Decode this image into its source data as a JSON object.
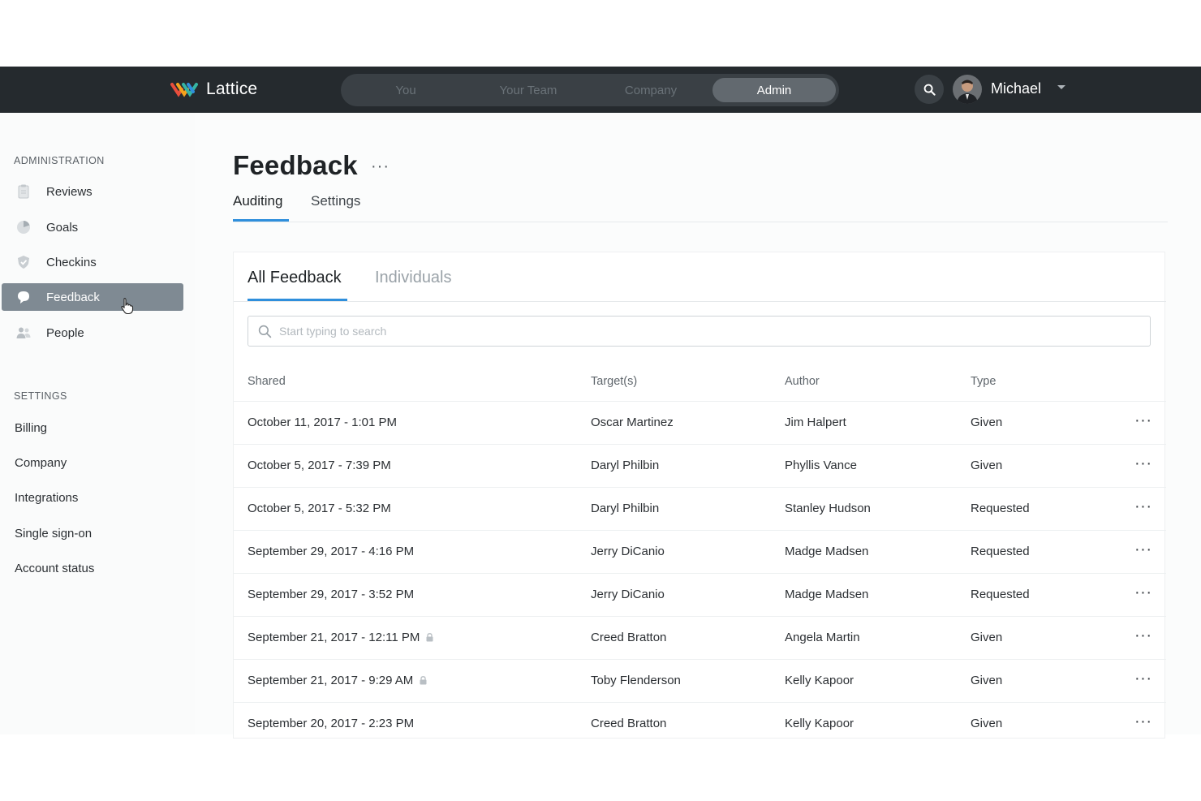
{
  "app": {
    "name": "Lattice",
    "colors": {
      "topbar": "#252a2e",
      "accent": "#2f8fdc",
      "active_sidebar": "#7f8a93"
    }
  },
  "topnav": {
    "items": [
      {
        "label": "You",
        "active": false
      },
      {
        "label": "Your Team",
        "active": false
      },
      {
        "label": "Company",
        "active": false
      },
      {
        "label": "Admin",
        "active": true
      }
    ],
    "search_icon": "search-icon",
    "user": {
      "name": "Michael",
      "caret_icon": "caret-down-icon"
    }
  },
  "sidebar": {
    "administration_heading": "ADMINISTRATION",
    "admin_items": [
      {
        "label": "Reviews",
        "icon": "clipboard-icon",
        "active": false
      },
      {
        "label": "Goals",
        "icon": "goal-pie-icon",
        "active": false
      },
      {
        "label": "Checkins",
        "icon": "checkin-shield-icon",
        "active": false
      },
      {
        "label": "Feedback",
        "icon": "chat-bubble-icon",
        "active": true
      },
      {
        "label": "People",
        "icon": "people-icon",
        "active": false
      }
    ],
    "settings_heading": "SETTINGS",
    "settings_items": [
      {
        "label": "Billing"
      },
      {
        "label": "Company"
      },
      {
        "label": "Integrations"
      },
      {
        "label": "Single sign-on"
      },
      {
        "label": "Account status"
      }
    ]
  },
  "page": {
    "title": "Feedback",
    "more": "···",
    "tabs": [
      {
        "label": "Auditing",
        "active": true
      },
      {
        "label": "Settings",
        "active": false
      }
    ]
  },
  "card": {
    "subtabs": [
      {
        "label": "All Feedback",
        "active": true
      },
      {
        "label": "Individuals",
        "active": false
      }
    ],
    "search": {
      "placeholder": "Start typing to search",
      "value": ""
    },
    "columns": [
      "Shared",
      "Target(s)",
      "Author",
      "Type"
    ],
    "rows": [
      {
        "shared": "October 11, 2017 - 1:01 PM",
        "locked": false,
        "target": "Oscar Martinez",
        "author": "Jim Halpert",
        "type": "Given"
      },
      {
        "shared": "October 5, 2017 - 7:39 PM",
        "locked": false,
        "target": "Daryl Philbin",
        "author": "Phyllis Vance",
        "type": "Given"
      },
      {
        "shared": "October 5, 2017 - 5:32 PM",
        "locked": false,
        "target": "Daryl Philbin",
        "author": "Stanley Hudson",
        "type": "Requested"
      },
      {
        "shared": "September 29, 2017 - 4:16 PM",
        "locked": false,
        "target": "Jerry DiCanio",
        "author": "Madge Madsen",
        "type": "Requested"
      },
      {
        "shared": "September 29, 2017 - 3:52 PM",
        "locked": false,
        "target": "Jerry DiCanio",
        "author": "Madge Madsen",
        "type": "Requested"
      },
      {
        "shared": "September 21, 2017 - 12:11 PM",
        "locked": true,
        "target": "Creed Bratton",
        "author": "Angela Martin",
        "type": "Given"
      },
      {
        "shared": "September 21, 2017 - 9:29 AM",
        "locked": true,
        "target": "Toby Flenderson",
        "author": "Kelly Kapoor",
        "type": "Given"
      },
      {
        "shared": "September 20, 2017 - 2:23 PM",
        "locked": false,
        "target": "Creed Bratton",
        "author": "Kelly Kapoor",
        "type": "Given"
      }
    ],
    "row_more": "···"
  }
}
